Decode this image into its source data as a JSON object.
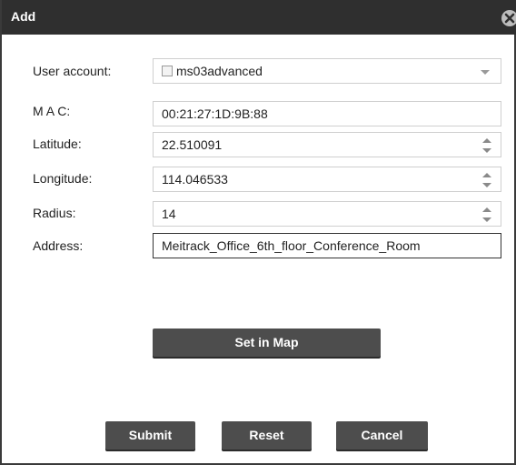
{
  "dialog": {
    "title": "Add",
    "close_icon": "close-circle-icon"
  },
  "form": {
    "user_account": {
      "label": "User account:",
      "value": "ms03advanced",
      "checked": false
    },
    "mac": {
      "label": "M A C:",
      "value": "00:21:27:1D:9B:88"
    },
    "latitude": {
      "label": "Latitude:",
      "value": "22.510091"
    },
    "longitude": {
      "label": "Longitude:",
      "value": "114.046533"
    },
    "radius": {
      "label": "Radius:",
      "value": "14"
    },
    "address": {
      "label": "Address:",
      "value": "Meitrack_Office_6th_floor_Conference_Room"
    }
  },
  "buttons": {
    "set_in_map": "Set in Map",
    "submit": "Submit",
    "reset": "Reset",
    "cancel": "Cancel"
  },
  "colors": {
    "titlebar": "#2f2f2f",
    "button": "#4d4d4d"
  }
}
